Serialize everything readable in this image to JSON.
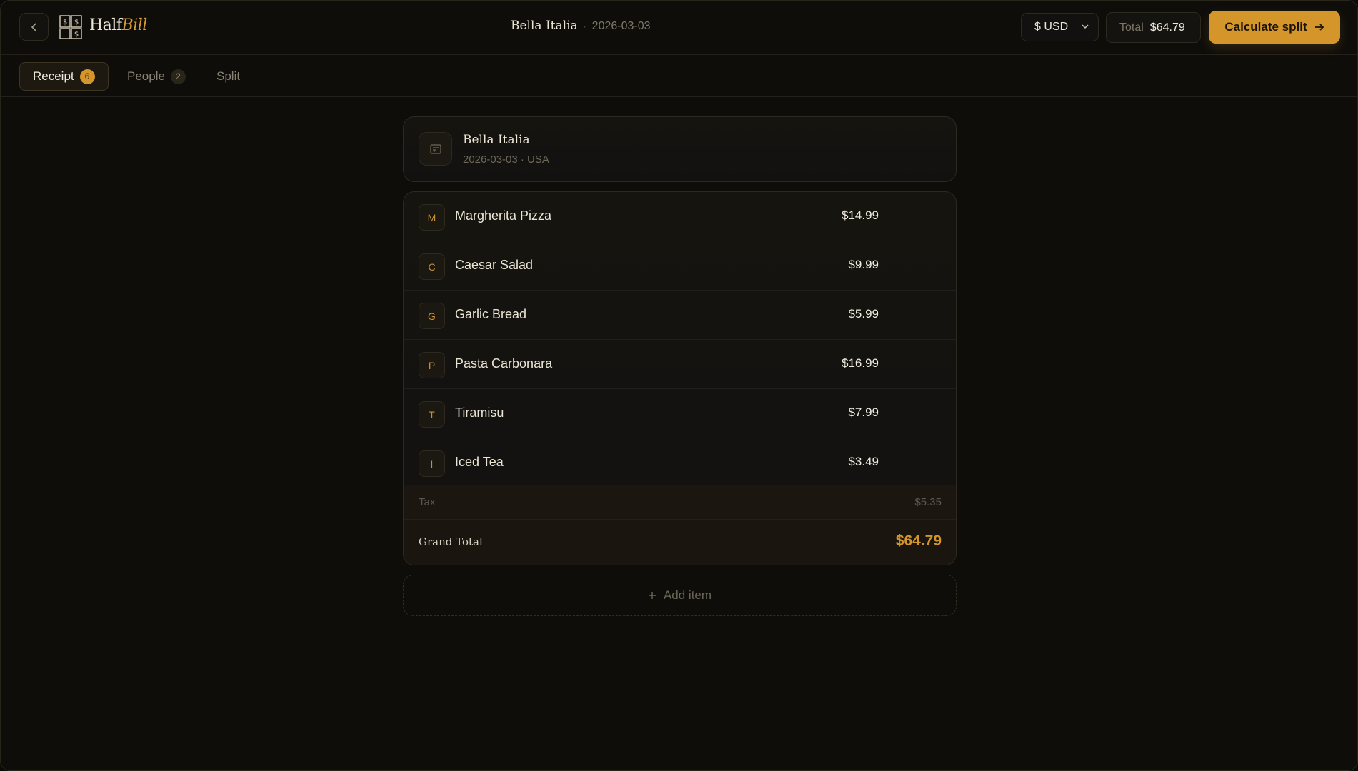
{
  "header": {
    "logo_main": "Half",
    "logo_accent": "Bill",
    "title": "Bella Italia",
    "separator": "·",
    "date": "2026-03-03",
    "currency": "$ USD",
    "total_label": "Total",
    "total_value": "$64.79",
    "calc_label": "Calculate split"
  },
  "tabs": [
    {
      "label": "Receipt",
      "badge": "6"
    },
    {
      "label": "People",
      "badge": "2"
    },
    {
      "label": "Split"
    }
  ],
  "restaurant": {
    "name": "Bella Italia",
    "meta": "2026-03-03 · USA"
  },
  "items": [
    {
      "initial": "M",
      "name": "Margherita Pizza",
      "price": "$14.99"
    },
    {
      "initial": "C",
      "name": "Caesar Salad",
      "price": "$9.99"
    },
    {
      "initial": "G",
      "name": "Garlic Bread",
      "price": "$5.99"
    },
    {
      "initial": "P",
      "name": "Pasta Carbonara",
      "price": "$16.99"
    },
    {
      "initial": "T",
      "name": "Tiramisu",
      "price": "$7.99"
    },
    {
      "initial": "I",
      "name": "Iced Tea",
      "price": "$3.49"
    }
  ],
  "tax": {
    "label": "Tax",
    "value": "$5.35"
  },
  "grand_total": {
    "label": "Grand Total",
    "value": "$64.79"
  },
  "add_item_label": "Add item",
  "colors": {
    "accent": "#d4962a",
    "background": "#0e0d0a"
  }
}
